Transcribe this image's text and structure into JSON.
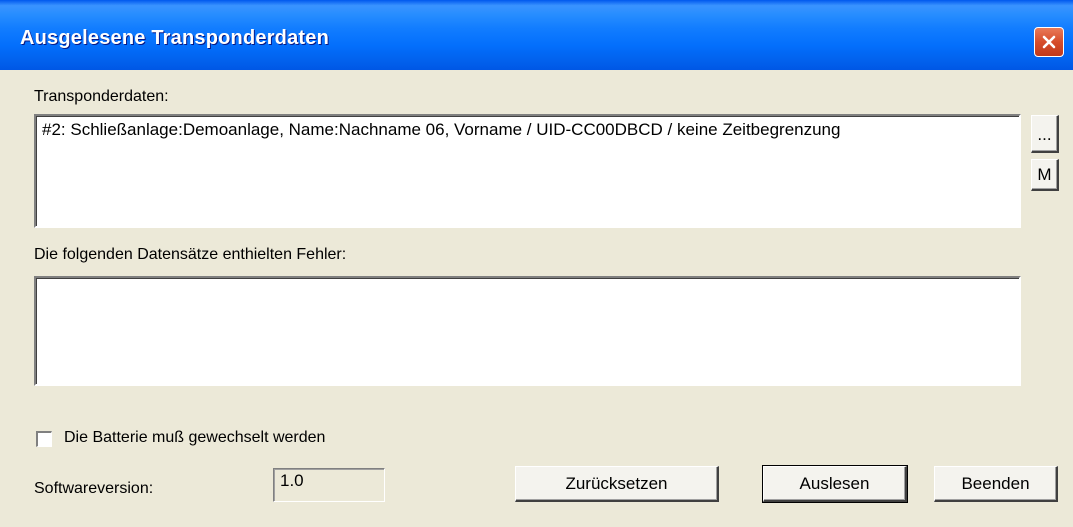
{
  "window": {
    "title": "Ausgelesene Transponderdaten",
    "close_icon": "close-icon"
  },
  "transponder": {
    "label": "Transponderdaten:",
    "content": "#2: Schließanlage:Demoanlage, Name:Nachname 06, Vorname / UID-CC00DBCD / keine Zeitbegrenzung",
    "browse_button": "...",
    "m_button": "M"
  },
  "errors": {
    "label": "Die folgenden Datensätze enthielten Fehler:",
    "content": ""
  },
  "battery": {
    "label": "Die Batterie muß gewechselt werden",
    "checked": false
  },
  "software": {
    "label": "Softwareversion:",
    "value": "1.0"
  },
  "buttons": {
    "reset": "Zurücksetzen",
    "read": "Auslesen",
    "quit": "Beenden"
  }
}
